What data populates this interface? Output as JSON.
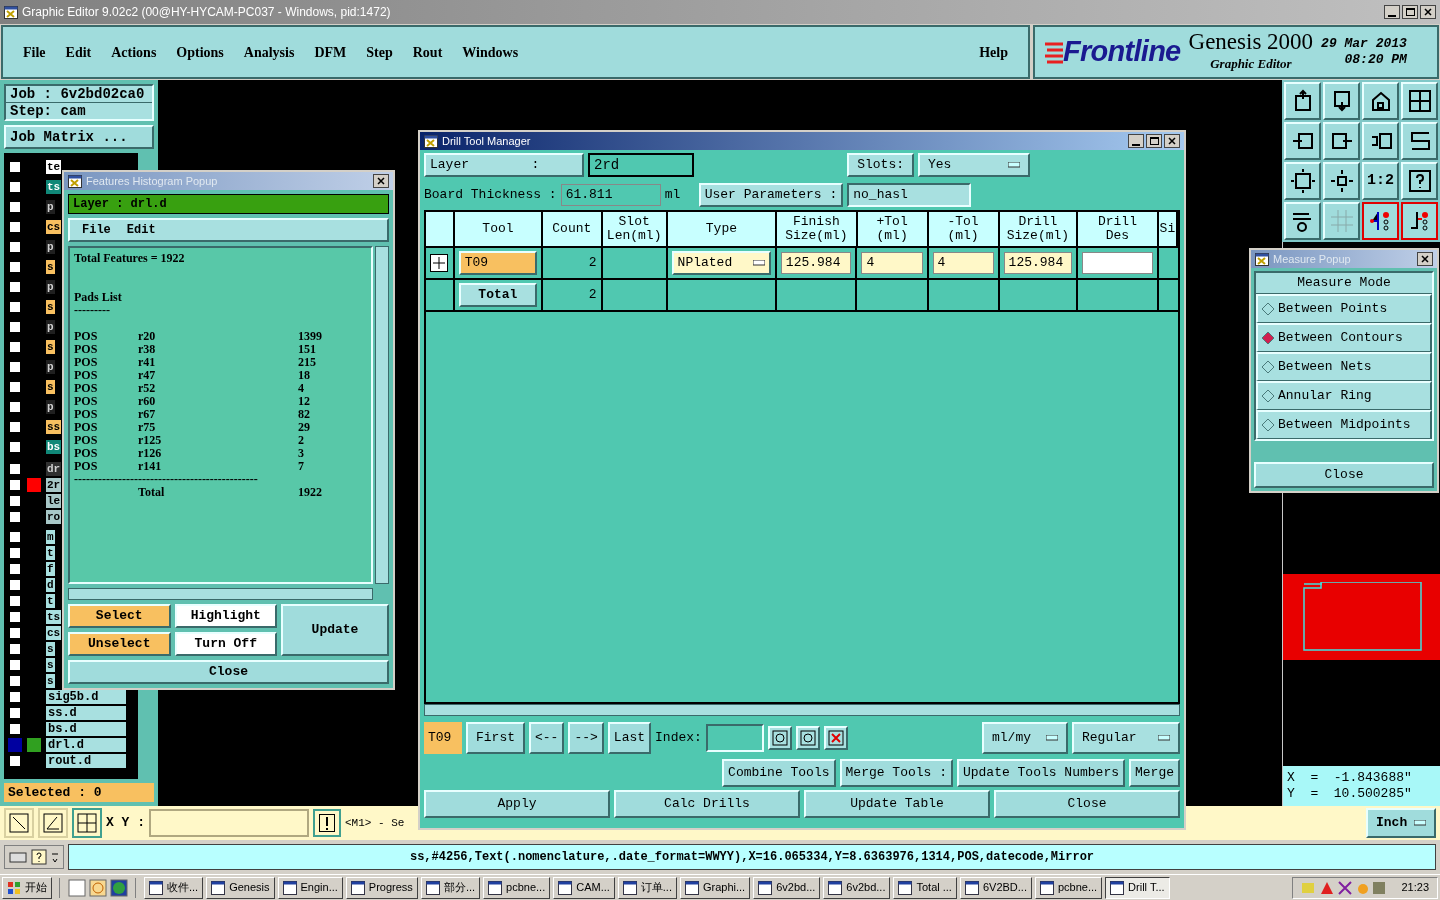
{
  "window": {
    "title": "Graphic Editor 9.02c2 (00@HY-HYCAM-PC037 - Windows, pid:1472)"
  },
  "menu": [
    "File",
    "Edit",
    "Actions",
    "Options",
    "Analysis",
    "DFM",
    "Step",
    "Rout",
    "Windows"
  ],
  "help": "Help",
  "brand": {
    "logo": "Frontline",
    "product": "Genesis 2000",
    "subtitle": "Graphic Editor",
    "date": "29 Mar 2013",
    "time": "08:20 PM"
  },
  "job": {
    "job": "Job  :  6v2bd02ca0",
    "step": "Step:  cam",
    "matrix_button": "Job Matrix ...",
    "selected": "Selected : 0"
  },
  "layer_groups": [
    [
      {
        "name": "te",
        "color": "#ffffff",
        "selected": false
      },
      {
        "name": "ts",
        "color": "#108878",
        "selected": false
      },
      {
        "name": "p",
        "color": "#202020",
        "selected": false
      },
      {
        "name": "cs",
        "color": "#f8c060",
        "selected": false
      },
      {
        "name": "p",
        "color": "#202020",
        "selected": false
      },
      {
        "name": "s",
        "color": "#f8c060",
        "selected": false
      },
      {
        "name": "p",
        "color": "#202020",
        "selected": false
      },
      {
        "name": "s",
        "color": "#f8c060",
        "selected": false
      },
      {
        "name": "p",
        "color": "#202020",
        "selected": false
      },
      {
        "name": "s",
        "color": "#f8c060",
        "selected": false
      },
      {
        "name": "p",
        "color": "#202020",
        "selected": false
      },
      {
        "name": "s",
        "color": "#f8c060",
        "selected": false
      },
      {
        "name": "p",
        "color": "#202020",
        "selected": false
      },
      {
        "name": "ss",
        "color": "#f8c060",
        "selected": false
      },
      {
        "name": "bs",
        "color": "#108878",
        "selected": false
      }
    ],
    [
      {
        "name": "dr",
        "color": "#303030",
        "selected": false
      },
      {
        "name": "2r",
        "color": "#a8c8c8",
        "swatch": {
          "color": "#ff0000"
        },
        "selected": false
      },
      {
        "name": "le",
        "color": "#a8c8c8",
        "selected": false
      },
      {
        "name": "ro",
        "color": "#a8c8c8",
        "selected": false
      }
    ],
    [
      {
        "name": "m",
        "color": "#a8e0e0",
        "selected": false
      },
      {
        "name": "t",
        "color": "#a8e0e0",
        "selected": false
      },
      {
        "name": "f",
        "color": "#a8e0e0",
        "selected": false
      },
      {
        "name": "d",
        "color": "#a8e0e0",
        "selected": false
      },
      {
        "name": "t",
        "color": "#a8e0e0",
        "selected": false
      },
      {
        "name": "ts",
        "color": "#a8e0e0",
        "selected": false
      },
      {
        "name": "cs",
        "color": "#a8e0e0",
        "selected": false
      },
      {
        "name": "s",
        "color": "#a8e0e0",
        "selected": false
      },
      {
        "name": "s",
        "color": "#a8e0e0",
        "selected": false
      },
      {
        "name": "s",
        "color": "#a8e0e0",
        "selected": false
      },
      {
        "name": "sig5b.d",
        "color": "#a8e0e0",
        "selected": false
      },
      {
        "name": "ss.d",
        "color": "#a8e0e0",
        "selected": false
      },
      {
        "name": "bs.d",
        "color": "#a8e0e0",
        "selected": false
      },
      {
        "name": "drl.d",
        "color": "#a8e0e0",
        "swatch": {
          "color": "#30a020"
        },
        "selected": true
      },
      {
        "name": "rout.d",
        "color": "#a8e0e0",
        "selected": false
      }
    ]
  ],
  "histogram": {
    "title": "Features Histogram Popup",
    "layer": "Layer :  drl.d",
    "menu": [
      "File",
      "Edit"
    ],
    "total_line": "Total Features = 1922",
    "list_title": "Pads List",
    "underline": "---------",
    "rows": [
      [
        "POS",
        "r20",
        "1399"
      ],
      [
        "POS",
        "r38",
        "151"
      ],
      [
        "POS",
        "r41",
        "215"
      ],
      [
        "POS",
        "r47",
        "18"
      ],
      [
        "POS",
        "r52",
        "4"
      ],
      [
        "POS",
        "r60",
        "12"
      ],
      [
        "POS",
        "r67",
        "82"
      ],
      [
        "POS",
        "r75",
        "29"
      ],
      [
        "POS",
        "r125",
        "2"
      ],
      [
        "POS",
        "r126",
        "3"
      ],
      [
        "POS",
        "r141",
        "7"
      ]
    ],
    "rule": "----------------------------------------------",
    "total_label": "Total",
    "total_value": "1922",
    "buttons": {
      "select": "Select",
      "highlight": "Highlight",
      "update": "Update",
      "unselect": "Unselect",
      "turn_off": "Turn Off",
      "close": "Close"
    }
  },
  "drill": {
    "title": "Drill Tool Manager",
    "layer_label": "Layer        :",
    "layer_value": "2rd",
    "slots_label": "Slots:",
    "slots_value": "Yes",
    "thickness_label": "Board Thickness :",
    "thickness_value": "61.811",
    "thickness_unit": "ml",
    "params_label": "User Parameters :",
    "params_value": "no_hasl",
    "columns": [
      "Tool",
      "Count",
      "Slot\nLen(ml)",
      "Type",
      "Finish\nSize(ml)",
      "+Tol\n(ml)",
      "-Tol\n(ml)",
      "Drill\nSize(ml)",
      "Drill\nDes",
      "Si"
    ],
    "rows": [
      {
        "kind": "tool",
        "tool": "T09",
        "count": "2",
        "type": "NPlated",
        "finish": "125.984",
        "plus_tol": "4",
        "minus_tol": "4",
        "drill_size": "125.984"
      },
      {
        "kind": "total",
        "tool": "Total",
        "count": "2"
      }
    ],
    "nav": {
      "current": "T09",
      "first": "First",
      "prev": "<--",
      "next": "-->",
      "last": "Last",
      "index_label": "Index:",
      "units": "ml/my",
      "mode": "Regular"
    },
    "tools_row": [
      "Combine Tools",
      "Merge Tools :",
      "Update Tools Numbers",
      "Merge"
    ],
    "actions": [
      "Apply",
      "Calc Drills",
      "Update Table",
      "Close"
    ]
  },
  "toolbar": [
    {
      "on": false
    },
    {
      "on": false
    },
    {
      "on": false
    },
    {
      "on": false
    },
    {
      "on": false
    },
    {
      "on": false
    },
    {
      "on": false
    },
    {
      "on": false
    },
    {
      "on": false
    },
    {
      "on": false
    },
    {
      "label": "1:2",
      "on": false
    },
    {
      "on": false
    },
    {
      "on": false
    },
    {
      "on": false
    },
    {
      "on": true
    },
    {
      "on": true
    }
  ],
  "measure": {
    "title": "Measure Popup",
    "heading": "Measure Mode",
    "options": [
      {
        "label": "Between Points",
        "selected": false
      },
      {
        "label": "Between Contours",
        "selected": true
      },
      {
        "label": "Between Nets",
        "selected": false
      },
      {
        "label": "Annular Ring",
        "selected": false
      },
      {
        "label": "Between Midpoints",
        "selected": false
      }
    ],
    "close": "Close"
  },
  "coords": {
    "x": "X  =  -1.843688\"",
    "y": "Y  =  10.500285\""
  },
  "bottom": {
    "xy_label": "X Y :",
    "hint": "<M1> - Se",
    "units": "Inch"
  },
  "status": "ss,#4256,Text(.nomenclature,.date_format=WWYY),X=16.065334,Y=8.6363976,1314,POS,datecode,Mirror",
  "taskbar": {
    "start": "开始",
    "items": [
      {
        "label": "收件...",
        "selected": false
      },
      {
        "label": "Genesis",
        "selected": false
      },
      {
        "label": "Engin...",
        "selected": false
      },
      {
        "label": "Progress",
        "selected": false
      },
      {
        "label": "部分...",
        "selected": false
      },
      {
        "label": "pcbne...",
        "selected": false
      },
      {
        "label": "CAM...",
        "selected": false
      },
      {
        "label": "订单...",
        "selected": false
      },
      {
        "label": "Graphi...",
        "selected": false
      },
      {
        "label": "6v2bd...",
        "selected": false
      },
      {
        "label": "6v2bd...",
        "selected": false
      },
      {
        "label": "Total ...",
        "selected": false
      },
      {
        "label": "6V2BD...",
        "selected": false
      },
      {
        "label": "pcbne...",
        "selected": false
      },
      {
        "label": "Drill T...",
        "selected": true
      }
    ],
    "clock": "21:23"
  }
}
